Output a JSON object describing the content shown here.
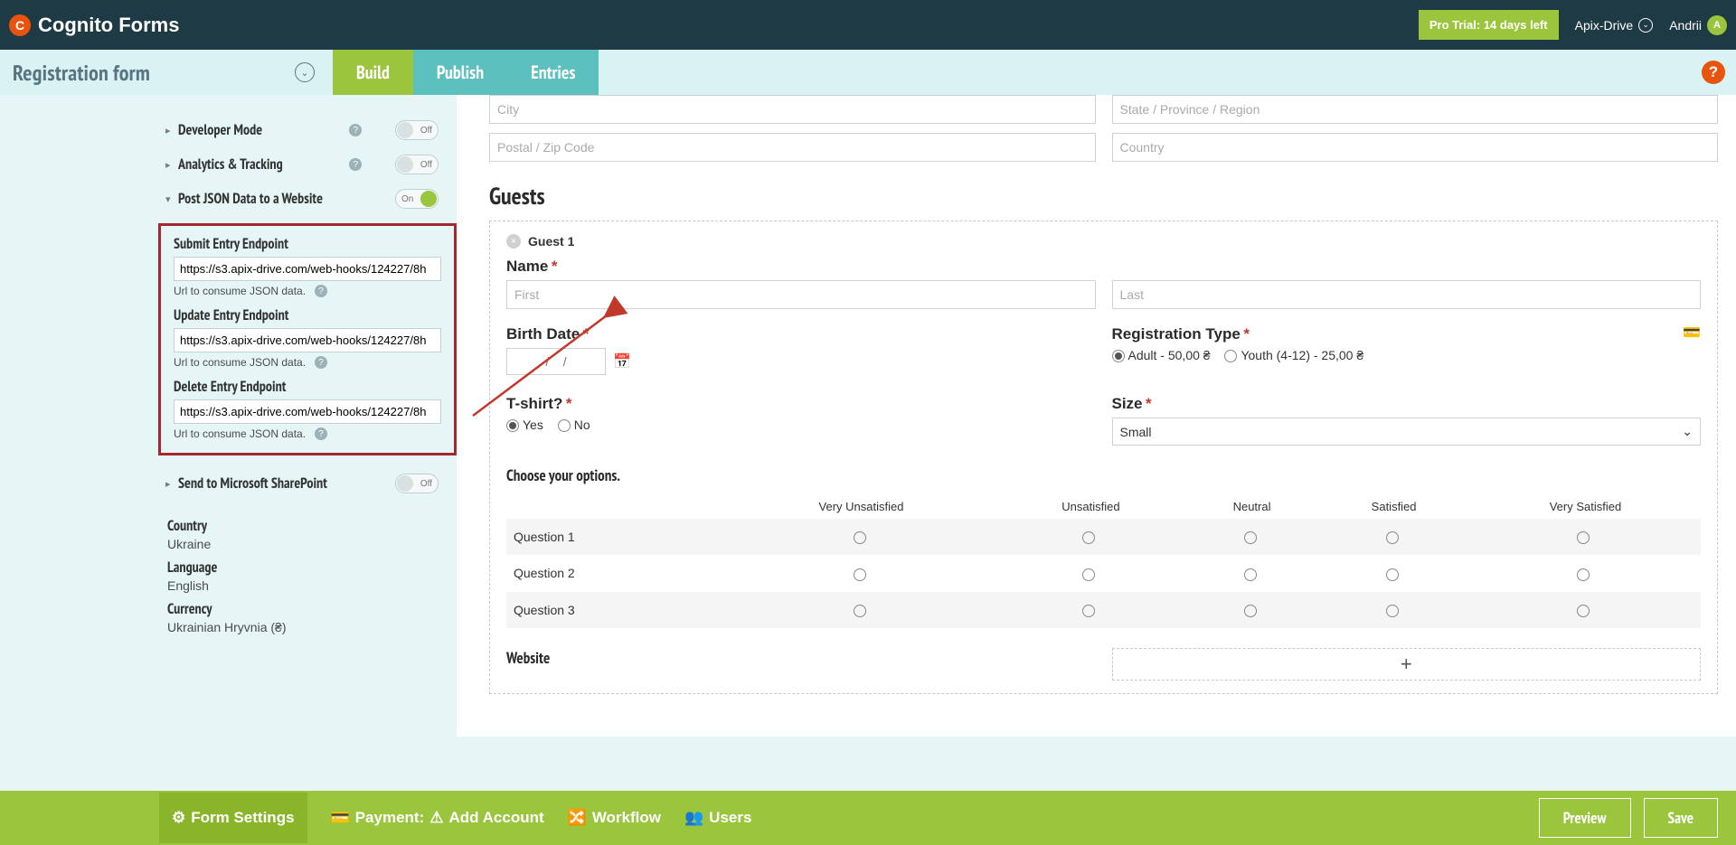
{
  "header": {
    "logo_text": "Cognito Forms",
    "pro_trial": "Pro Trial: 14 days left",
    "org": "Apix-Drive",
    "user": "Andrii",
    "user_initial": "A"
  },
  "subbar": {
    "form_name": "Registration form",
    "tabs": {
      "build": "Build",
      "publish": "Publish",
      "entries": "Entries"
    }
  },
  "settings": {
    "developer_mode": {
      "label": "Developer Mode",
      "state": "Off"
    },
    "analytics": {
      "label": "Analytics & Tracking",
      "state": "Off"
    },
    "post_json": {
      "label": "Post JSON Data to a Website",
      "state": "On"
    },
    "sharepoint": {
      "label": "Send to Microsoft SharePoint",
      "state": "Off"
    },
    "endpoints": {
      "submit": {
        "label": "Submit Entry Endpoint",
        "value": "https://s3.apix-drive.com/web-hooks/124227/8h",
        "hint": "Url to consume JSON data."
      },
      "update": {
        "label": "Update Entry Endpoint",
        "value": "https://s3.apix-drive.com/web-hooks/124227/8h",
        "hint": "Url to consume JSON data."
      },
      "delete": {
        "label": "Delete Entry Endpoint",
        "value": "https://s3.apix-drive.com/web-hooks/124227/8h",
        "hint": "Url to consume JSON data."
      }
    },
    "locale": {
      "country_label": "Country",
      "country": "Ukraine",
      "language_label": "Language",
      "language": "English",
      "currency_label": "Currency",
      "currency": "Ukrainian Hryvnia (₴)"
    }
  },
  "preview": {
    "city": "City",
    "state": "State / Province / Region",
    "zip": "Postal / Zip Code",
    "country": "Country",
    "guests_title": "Guests",
    "guest1": "Guest 1",
    "name_label": "Name",
    "first": "First",
    "last": "Last",
    "birth_label": "Birth Date",
    "birth_placeholder": "/    /",
    "reg_type_label": "Registration Type",
    "reg_adult": "Adult - 50,00 ₴",
    "reg_youth": "Youth (4-12) - 25,00 ₴",
    "tshirt_label": "T-shirt?",
    "yes": "Yes",
    "no": "No",
    "size_label": "Size",
    "size_value": "Small",
    "options_label": "Choose your options.",
    "matrix_headers": [
      "Very Unsatisfied",
      "Unsatisfied",
      "Neutral",
      "Satisfied",
      "Very Satisfied"
    ],
    "q1": "Question 1",
    "q2": "Question 2",
    "q3": "Question 3",
    "website": "Website"
  },
  "footer": {
    "form_settings": "Form Settings",
    "payment": "Payment:",
    "add_account": "Add Account",
    "workflow": "Workflow",
    "users": "Users",
    "preview": "Preview",
    "save": "Save"
  }
}
